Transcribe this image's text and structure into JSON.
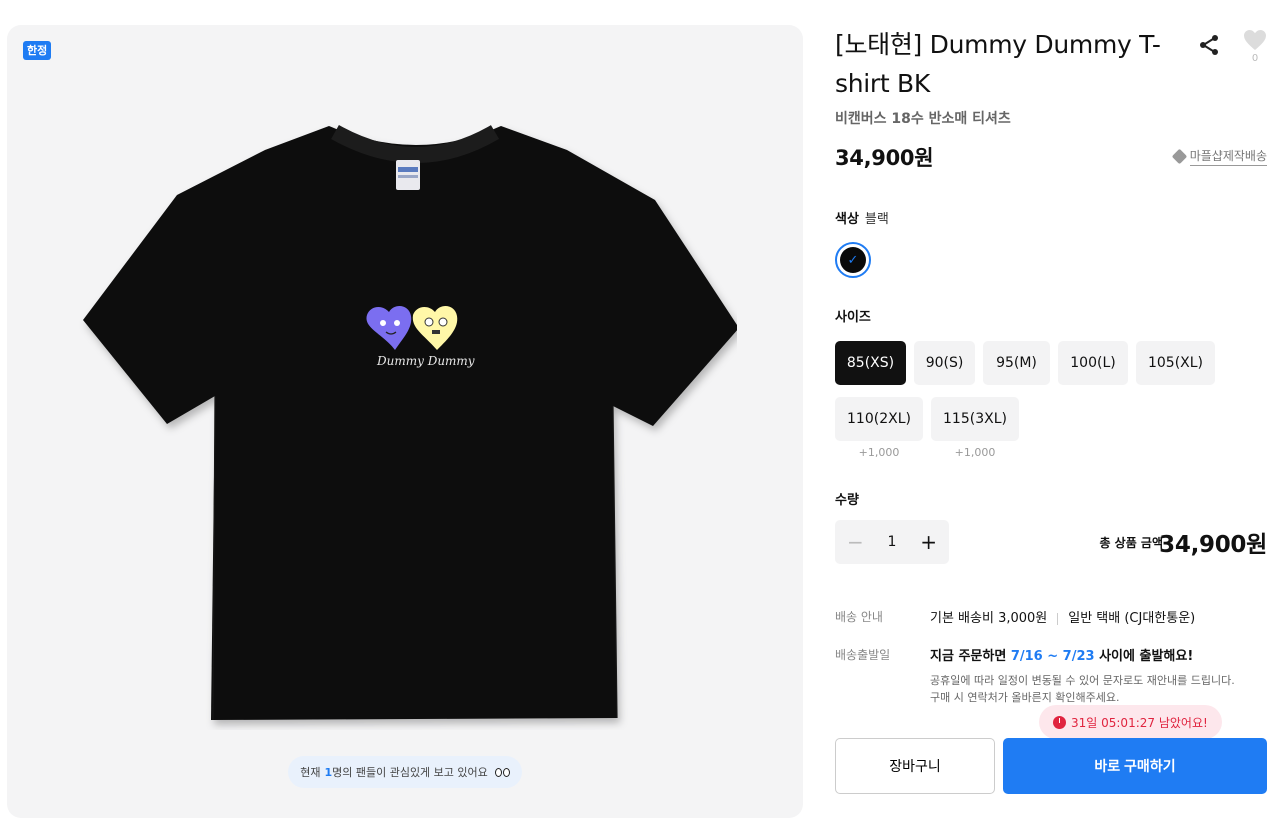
{
  "gallery": {
    "badge": "한정",
    "print_text": "Dummy Dummy",
    "viewers": {
      "prefix": "현재",
      "count": "1",
      "suffix": "명의 팬들이 관심있게 보고 있어요",
      "icon": "eyes-icon"
    }
  },
  "product": {
    "title": "[노태현] Dummy Dummy T-shirt BK",
    "subtitle": "비캔버스 18수 반소매 티셔츠",
    "price": "34,900원",
    "like_count": "0",
    "made_to_order": "마플샵제작배송"
  },
  "options": {
    "color": {
      "label": "색상",
      "value": "블랙",
      "swatch": "#0a0a0a"
    },
    "size": {
      "label": "사이즈",
      "items": [
        {
          "label": "85(XS)",
          "extra": ""
        },
        {
          "label": "90(S)",
          "extra": ""
        },
        {
          "label": "95(M)",
          "extra": ""
        },
        {
          "label": "100(L)",
          "extra": ""
        },
        {
          "label": "105(XL)",
          "extra": ""
        },
        {
          "label": "110(2XL)",
          "extra": "+1,000"
        },
        {
          "label": "115(3XL)",
          "extra": "+1,000"
        }
      ],
      "selected": "85(XS)"
    },
    "quantity": {
      "label": "수량",
      "value": "1"
    }
  },
  "total": {
    "label": "총 상품 금액",
    "value": "34,900원"
  },
  "shipping": {
    "info_label": "배송 안내",
    "base_fee": "기본 배송비 3,000원",
    "carrier": "일반 택배 (CJ대한통운)",
    "dispatch_label": "배송출발일",
    "dispatch_prefix": "지금 주문하면",
    "dispatch_dates": "7/16 ~ 7/23",
    "dispatch_suffix": "사이에 출발해요!",
    "note_1": "공휴일에 따라 일정이 변동될 수 있어 문자로도 재안내를 드립니다.",
    "note_2": "구매 시 연락처가 올바른지 확인해주세요."
  },
  "countdown": "31일 05:01:27 남았어요!",
  "actions": {
    "cart": "장바구니",
    "buy": "바로 구매하기"
  },
  "colors": {
    "accent": "#1f7cf3",
    "alert": "#e0243f",
    "shirt": "#0a0a0a"
  }
}
